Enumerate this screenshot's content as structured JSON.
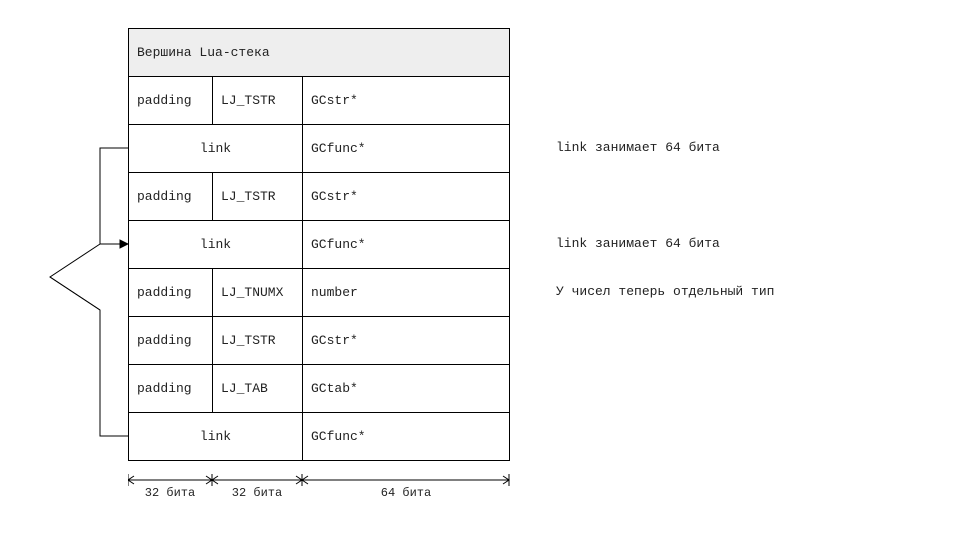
{
  "header": "Вершина Lua-стека",
  "rows": [
    {
      "a": "padding",
      "b": "LJ_TSTR",
      "c": "GCstr*"
    },
    {
      "ab": "link",
      "c": "GCfunc*",
      "note": "link занимает 64 бита"
    },
    {
      "a": "padding",
      "b": "LJ_TSTR",
      "c": "GCstr*"
    },
    {
      "ab": "link",
      "c": "GCfunc*",
      "note": "link занимает 64 бита"
    },
    {
      "a": "padding",
      "b": "LJ_TNUMX",
      "c": "number",
      "note": "У чисел теперь отдельный тип"
    },
    {
      "a": "padding",
      "b": "LJ_TSTR",
      "c": "GCstr*"
    },
    {
      "a": "padding",
      "b": "LJ_TAB",
      "c": "GCtab*"
    },
    {
      "ab": "link",
      "c": "GCfunc*"
    }
  ],
  "ruler": {
    "a": "32 бита",
    "b": "32 бита",
    "c": "64 бита"
  },
  "chart_data": {
    "type": "table",
    "title": "Вершина Lua-стека",
    "columns": [
      "32 бита",
      "32 бита",
      "64 бита"
    ],
    "rows": [
      [
        "padding",
        "LJ_TSTR",
        "GCstr*"
      ],
      [
        "link",
        "link",
        "GCfunc*"
      ],
      [
        "padding",
        "LJ_TSTR",
        "GCstr*"
      ],
      [
        "link",
        "link",
        "GCfunc*"
      ],
      [
        "padding",
        "LJ_TNUMX",
        "number"
      ],
      [
        "padding",
        "LJ_TSTR",
        "GCstr*"
      ],
      [
        "padding",
        "LJ_TAB",
        "GCtab*"
      ],
      [
        "link",
        "link",
        "GCfunc*"
      ]
    ],
    "annotations": [
      "link занимает 64 бита",
      "link занимает 64 бита",
      "У чисел теперь отдельный тип"
    ],
    "link_arrows": [
      {
        "from_row": 2,
        "to_row": 4,
        "desc": "second link points to first link slot"
      },
      {
        "from_row": 8,
        "to_row": 4,
        "desc": "bottom link points up to middle link slot"
      }
    ]
  }
}
